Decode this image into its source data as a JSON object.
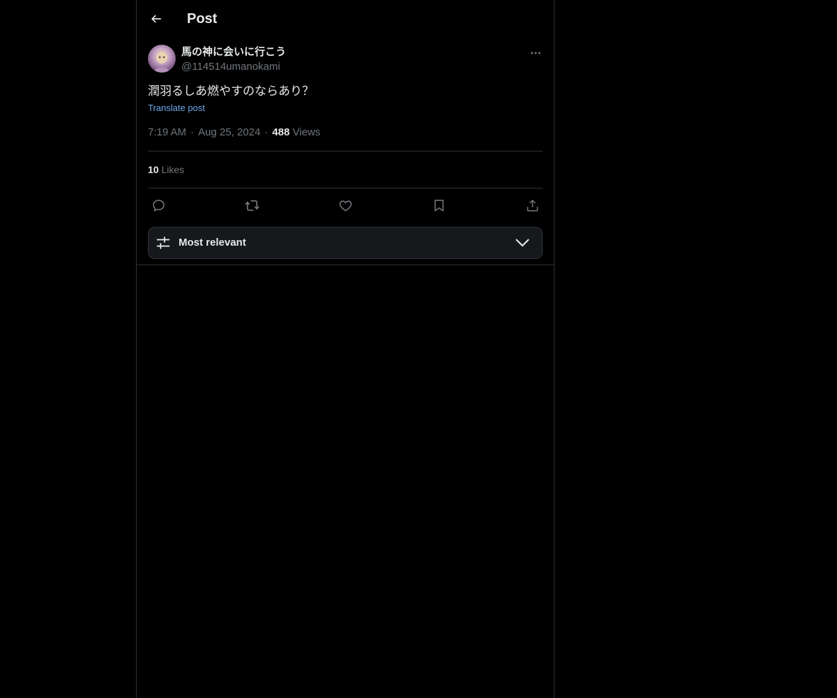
{
  "header": {
    "title": "Post",
    "back_icon": "arrow-left-icon"
  },
  "post": {
    "author": {
      "display_name": "馬の神に会いに行こう",
      "handle": "@114514umanokami"
    },
    "text": "潤羽るしあ燃やすのならあり？",
    "translate_label": "Translate post",
    "time": "7:19 AM",
    "date": "Aug 25, 2024",
    "separator": "·",
    "views_count": "488",
    "views_label": "Views",
    "likes_count": "10",
    "likes_label": "Likes"
  },
  "actions": [
    "reply-icon",
    "repost-icon",
    "like-icon",
    "bookmark-icon",
    "share-icon"
  ],
  "sort": {
    "label": "Most relevant",
    "icon": "sliders-icon"
  },
  "colors": {
    "background": "#000000",
    "text_primary": "#e7e9ea",
    "text_secondary": "#71767b",
    "link": "#6ea8ec",
    "border": "#2f3336"
  }
}
